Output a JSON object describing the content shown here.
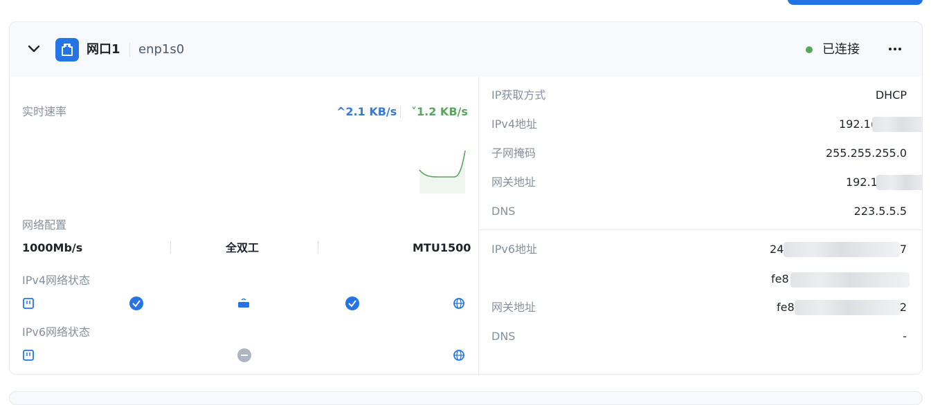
{
  "card": {
    "name": "网口1",
    "device": "enp1s0",
    "status": "已连接",
    "colors": {
      "accent": "#2474e5",
      "connected": "#58a65c",
      "download": "#58a65c",
      "upload": "#2f7be0"
    }
  },
  "left": {
    "speed_label": "实时速率",
    "upload_speed": "2.1 KB/s",
    "download_speed": "1.2 KB/s",
    "config_label": "网络配置",
    "config": {
      "speed": "1000Mb/s",
      "duplex": "全双工",
      "mtu": "MTU1500"
    },
    "ipv4_status_label": "IPv4网络状态",
    "ipv6_status_label": "IPv6网络状态"
  },
  "right": {
    "ipv4": [
      {
        "label": "IP获取方式",
        "value": "DHCP"
      },
      {
        "label": "IPv4地址",
        "value": "192.1("
      },
      {
        "label": "子网掩码",
        "value": "255.255.255.0"
      },
      {
        "label": "网关地址",
        "value": "192.1"
      },
      {
        "label": "DNS",
        "value": "223.5.5.5"
      }
    ],
    "ipv6": [
      {
        "label": "IPv6地址",
        "value": "24",
        "suffix": "7"
      },
      {
        "label": "",
        "value": "fe8"
      },
      {
        "label": "网关地址",
        "value": "fe8",
        "suffix": "2"
      },
      {
        "label": "DNS",
        "value": "-"
      }
    ]
  },
  "icons": [
    "chevron-down-icon",
    "ethernet-port-icon",
    "more-icon",
    "arrow-up-icon",
    "arrow-down-icon",
    "nic-icon",
    "router-icon",
    "globe-icon",
    "check-icon",
    "minus-icon"
  ]
}
